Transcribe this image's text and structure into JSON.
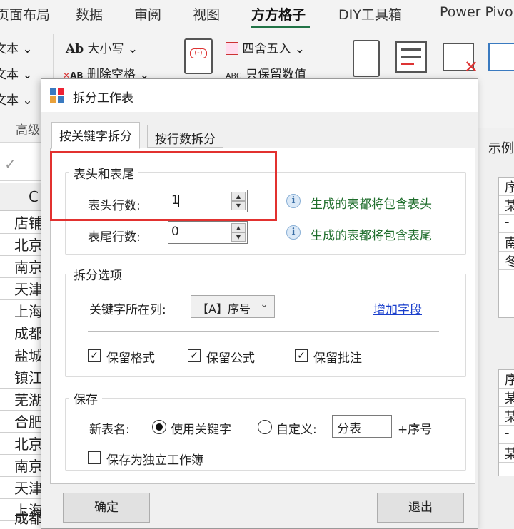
{
  "ribbon": {
    "tabs": [
      {
        "label": "页面布局"
      },
      {
        "label": "数据"
      },
      {
        "label": "审阅"
      },
      {
        "label": "视图"
      },
      {
        "label": "方方格子"
      },
      {
        "label": "DIY工具箱"
      },
      {
        "label": "Power Pivo"
      }
    ],
    "left_items": [
      "文本",
      "文本",
      "文本",
      "高级"
    ],
    "case_label": "大小写",
    "remove_spaces_label": "删除空格",
    "round_label": "四舍五入",
    "keep_value_label": "只保留数值",
    "abc_label": "ABC",
    "ab_label": "Ab"
  },
  "sheet": {
    "column_letter": "C",
    "cells": [
      "店铺",
      "北京",
      "南京",
      "天津",
      "上海",
      "成都",
      "盐城",
      "镇江",
      "芜湖",
      "合肥",
      "北京",
      "南京",
      "天津",
      "上海",
      "成都"
    ]
  },
  "example": {
    "label": "示例",
    "mini1": [
      "序",
      "某",
      "-",
      "南",
      "冬"
    ],
    "mini2": [
      "序",
      "某",
      "某",
      "-",
      "某"
    ]
  },
  "dialog": {
    "title": "拆分工作表",
    "tabs": [
      "按关键字拆分",
      "按行数拆分"
    ],
    "header_footer": {
      "title": "表头和表尾",
      "header_rows_label": "表头行数:",
      "header_rows_value": "1",
      "footer_rows_label": "表尾行数:",
      "footer_rows_value": "0",
      "header_hint": "生成的表都将包含表头",
      "footer_hint": "生成的表都将包含表尾"
    },
    "split_options": {
      "title": "拆分选项",
      "key_column_label": "关键字所在列:",
      "key_column_value": "【A】序号",
      "add_field_link": "增加字段",
      "keep_format": "保留格式",
      "keep_formula": "保留公式",
      "keep_comment": "保留批注"
    },
    "save": {
      "title": "保存",
      "new_sheet_name_label": "新表名:",
      "use_keyword": "使用关键字",
      "custom": "自定义:",
      "custom_value": "分表",
      "suffix": "+序号",
      "save_as_workbook": "保存为独立工作簿"
    },
    "ok_button": "确定",
    "exit_button": "退出"
  },
  "colors": {
    "accent": "#217346",
    "highlight": "#e2312f",
    "hint_text": "#1f6e2c",
    "link": "#1a3fcc"
  }
}
